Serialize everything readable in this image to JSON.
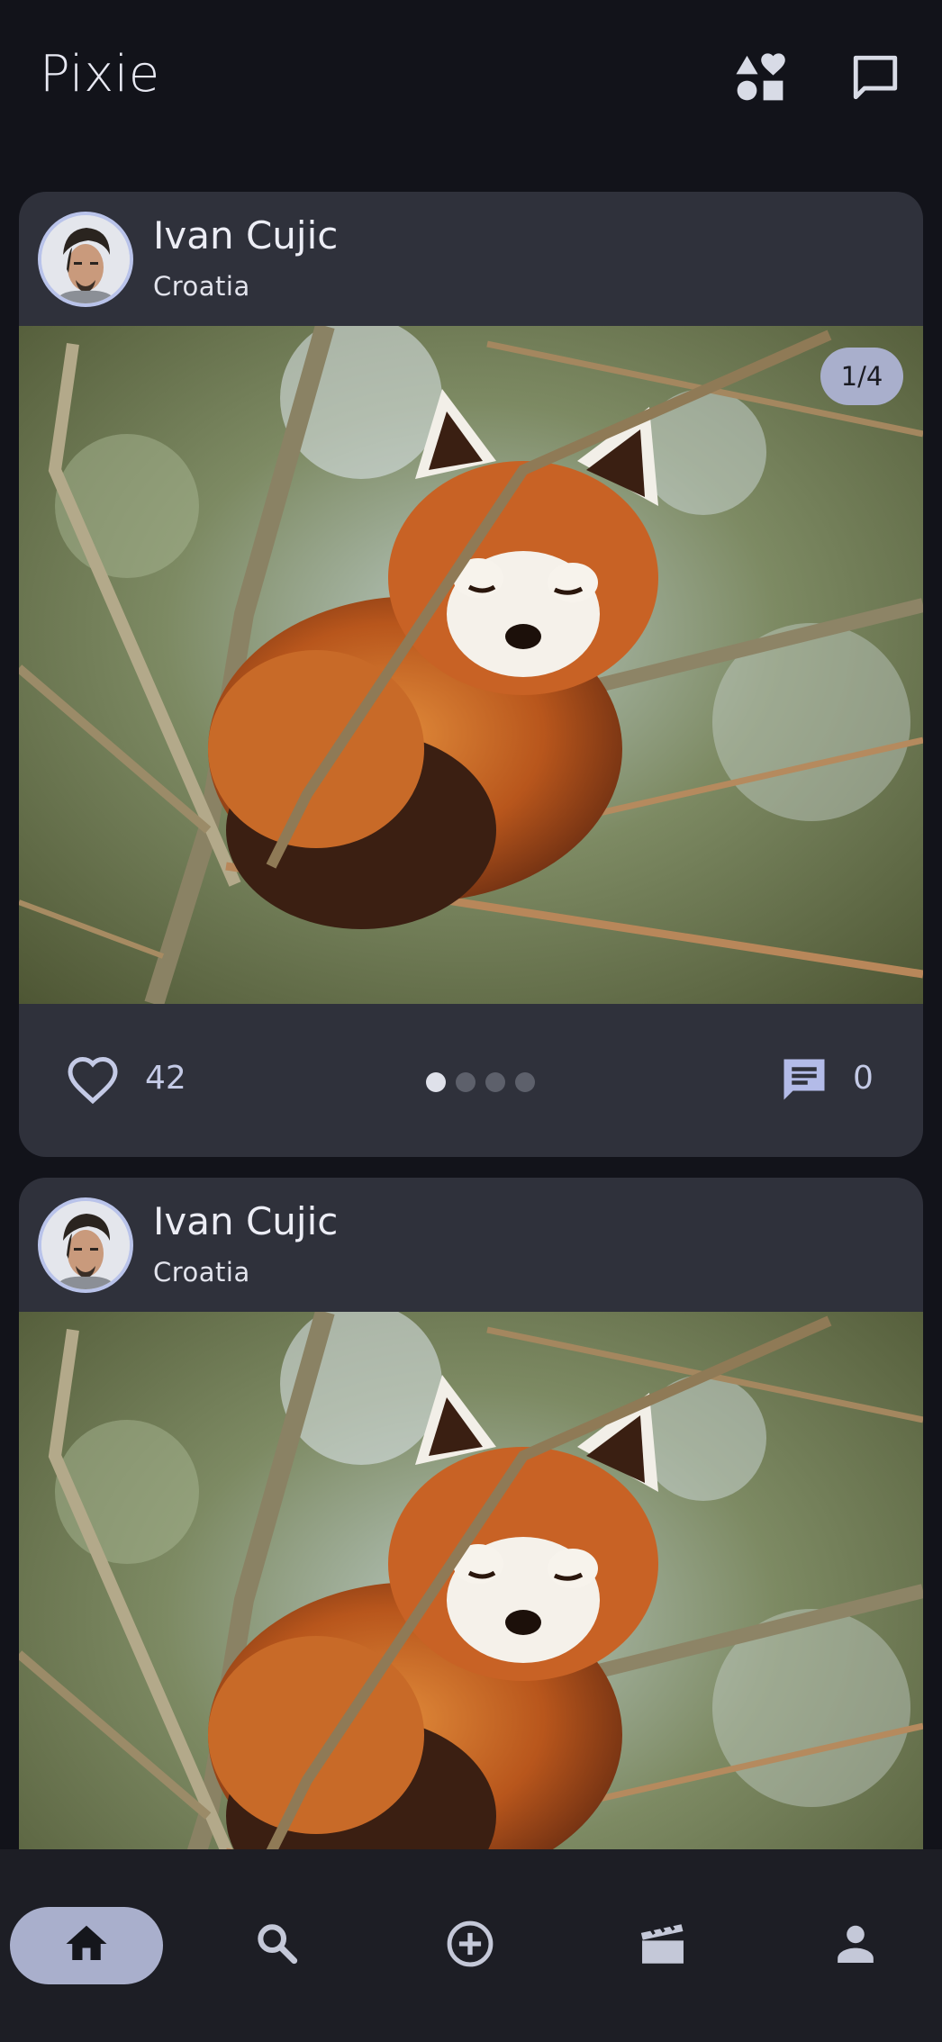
{
  "app": {
    "title": "Pixie"
  },
  "header": {
    "icons": [
      "shapes-icon",
      "chat-bubble-icon"
    ]
  },
  "posts": [
    {
      "author": "Ivan Cujic",
      "location": "Croatia",
      "image_counter": "1/4",
      "likes": "42",
      "comments": "0",
      "carousel": {
        "count": 4,
        "active_index": 0
      }
    },
    {
      "author": "Ivan Cujic",
      "location": "Croatia"
    }
  ],
  "bottom_nav": {
    "items": [
      "home-icon",
      "search-icon",
      "add-circle-icon",
      "movie-clapper-icon",
      "person-icon"
    ],
    "active": "home"
  },
  "colors": {
    "background": "#12131a",
    "card": "#2f313b",
    "accent": "#a9afcc",
    "nav": "#1d1e25"
  }
}
